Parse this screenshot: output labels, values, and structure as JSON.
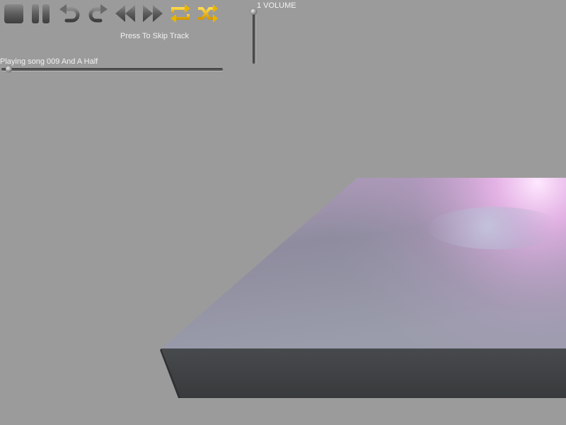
{
  "player": {
    "skip_hint": "Press To Skip Track",
    "now_playing": "Playing song 009 And A Half",
    "volume_label": "1 VOLUME",
    "progress": 0.02,
    "volume": 1.0
  },
  "toolbar": {
    "buttons": [
      {
        "name": "stop",
        "icon": "stop-icon"
      },
      {
        "name": "pause",
        "icon": "pause-icon"
      },
      {
        "name": "undo",
        "icon": "undo-icon"
      },
      {
        "name": "redo",
        "icon": "redo-icon"
      },
      {
        "name": "rewind",
        "icon": "rewind-icon"
      },
      {
        "name": "fast-forward",
        "icon": "fast-forward-icon"
      },
      {
        "name": "repeat",
        "icon": "repeat-icon",
        "active": true
      },
      {
        "name": "shuffle",
        "icon": "shuffle-icon",
        "active": true
      }
    ]
  },
  "colors": {
    "background": "#9b9b9b",
    "icon_gray": "#5a5a5a",
    "icon_active": "#e8b400",
    "platform_side": "#3f4244",
    "platform_glow": "#f3c6f0"
  }
}
